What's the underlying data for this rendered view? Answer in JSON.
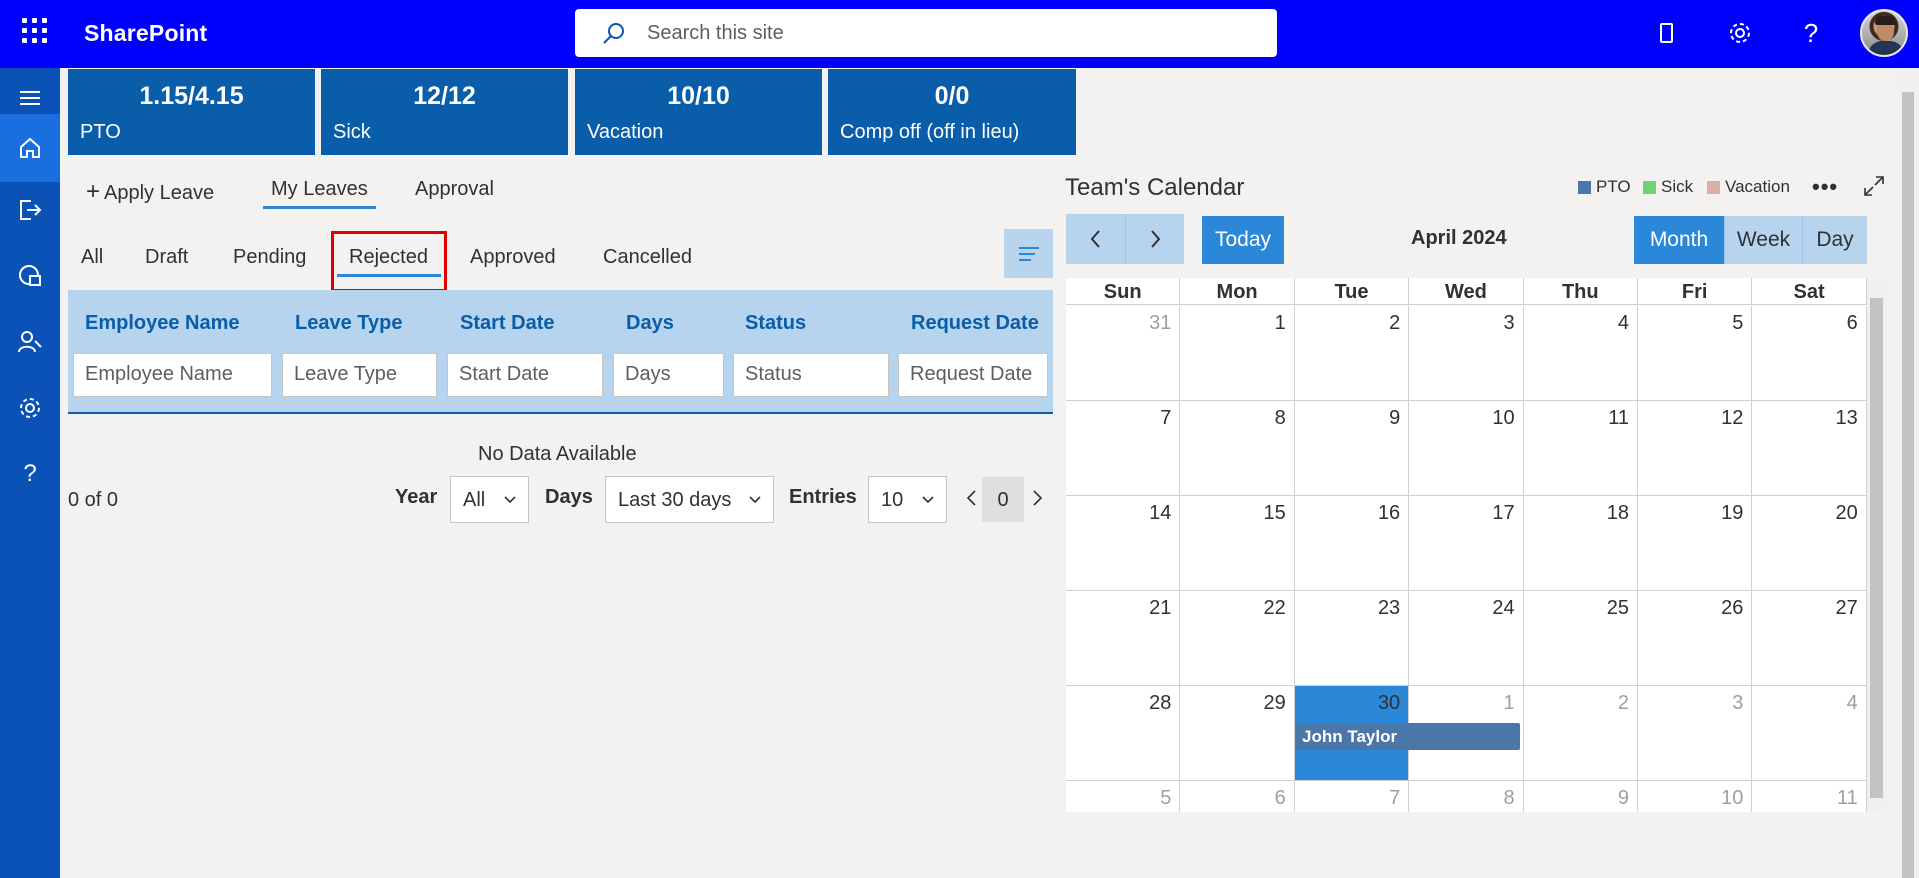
{
  "app": {
    "brand": "SharePoint",
    "search_placeholder": "Search this site"
  },
  "stats": [
    {
      "value": "1.15/4.15",
      "label": "PTO"
    },
    {
      "value": "12/12",
      "label": "Sick"
    },
    {
      "value": "10/10",
      "label": "Vacation"
    },
    {
      "value": "0/0",
      "label": "Comp off (off in lieu)"
    }
  ],
  "tabs": {
    "apply": "Apply Leave",
    "my_leaves": "My Leaves",
    "approval": "Approval"
  },
  "subtabs": [
    "All",
    "Draft",
    "Pending",
    "Rejected",
    "Approved",
    "Cancelled"
  ],
  "table": {
    "columns": [
      "Employee Name",
      "Leave Type",
      "Start Date",
      "Days",
      "Status",
      "Request Date"
    ],
    "filters": [
      "Employee Name",
      "Leave Type",
      "Start Date",
      "Days",
      "Status",
      "Request Date"
    ],
    "empty": "No Data Available",
    "count": "0 of 0"
  },
  "filters": {
    "year_label": "Year",
    "year_value": "All",
    "days_label": "Days",
    "days_value": "Last 30 days",
    "entries_label": "Entries",
    "entries_value": "10",
    "page": "0"
  },
  "calendar": {
    "title": "Team's Calendar",
    "legend": [
      {
        "label": "PTO",
        "color": "#4a76a8"
      },
      {
        "label": "Sick",
        "color": "#6fd36f"
      },
      {
        "label": "Vacation",
        "color": "#d8b0a6"
      }
    ],
    "today_label": "Today",
    "month_label": "April 2024",
    "views": [
      "Month",
      "Week",
      "Day"
    ],
    "active_view": "Month",
    "days_of_week": [
      "Sun",
      "Mon",
      "Tue",
      "Wed",
      "Thu",
      "Fri",
      "Sat"
    ],
    "weeks": [
      [
        "31",
        "1",
        "2",
        "3",
        "4",
        "5",
        "6"
      ],
      [
        "7",
        "8",
        "9",
        "10",
        "11",
        "12",
        "13"
      ],
      [
        "14",
        "15",
        "16",
        "17",
        "18",
        "19",
        "20"
      ],
      [
        "21",
        "22",
        "23",
        "24",
        "25",
        "26",
        "27"
      ],
      [
        "28",
        "29",
        "30",
        "1",
        "2",
        "3",
        "4"
      ],
      [
        "5",
        "6",
        "7",
        "8",
        "9",
        "10",
        "11"
      ]
    ],
    "event": {
      "name": "John Taylor"
    }
  }
}
